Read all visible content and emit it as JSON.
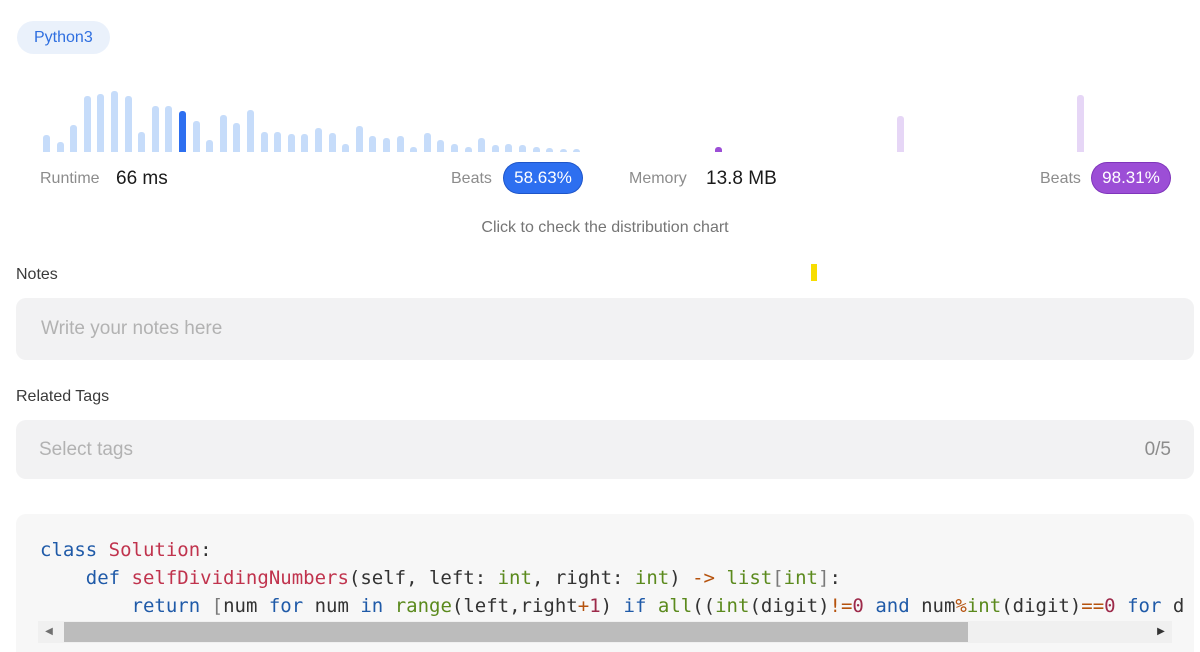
{
  "language": "Python3",
  "runtime": {
    "label": "Runtime",
    "value": "66 ms",
    "beats_label": "Beats",
    "beats_value": "58.63%"
  },
  "memory": {
    "label": "Memory",
    "value": "13.8 MB",
    "beats_label": "Beats",
    "beats_value": "98.31%"
  },
  "chart_hint": "Click to check the distribution chart",
  "notes": {
    "title": "Notes",
    "placeholder": "Write your notes here"
  },
  "tags": {
    "title": "Related Tags",
    "placeholder": "Select tags",
    "count": "0/5"
  },
  "colors": {
    "runtime_accent": "#2d6ff0",
    "memory_accent": "#9c4ed6",
    "bar_light_blue": "#c6dcfa",
    "bar_light_purple": "#e6d6f6"
  },
  "code_lines": [
    "class Solution:",
    "    def selfDividingNumbers(self, left: int, right: int) -> list[int]:",
    "        return [num for num in range(left,right+1) if all((int(digit)!=0 and num%int(digit)==0 for d"
  ],
  "runtime_distribution": [
    0.25,
    0.15,
    0.4,
    0.82,
    0.86,
    0.9,
    0.82,
    0.3,
    0.68,
    0.68,
    0.6,
    0.46,
    0.18,
    0.55,
    0.42,
    0.62,
    0.3,
    0.3,
    0.27,
    0.27,
    0.35,
    0.28,
    0.12,
    0.38,
    0.24,
    0.2,
    0.24,
    0.08,
    0.28,
    0.17,
    0.12,
    0.08,
    0.2,
    0.1,
    0.12,
    0.1,
    0.08,
    0.06,
    0.05,
    0.05
  ],
  "runtime_selected_index": 10,
  "memory_distribution": [
    0.07,
    0.53,
    0.84
  ],
  "memory_selected_index": 0
}
